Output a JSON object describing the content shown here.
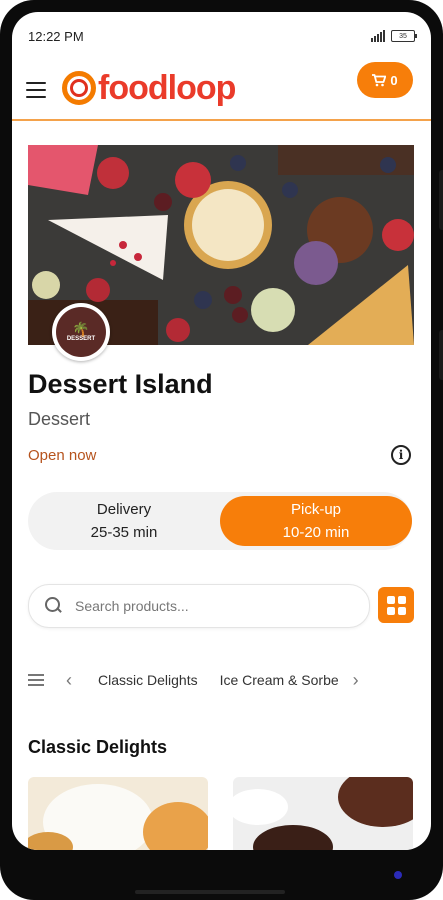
{
  "status_bar": {
    "time": "12:22 PM",
    "battery": "35"
  },
  "header": {
    "logo_text": "foodloop",
    "cart_count": "0"
  },
  "restaurant": {
    "name": "Dessert Island",
    "category": "Dessert",
    "open_status": "Open now",
    "logo_text": "DESSERT"
  },
  "order_mode": {
    "delivery": {
      "label": "Delivery",
      "time": "25-35 min"
    },
    "pickup": {
      "label": "Pick-up",
      "time": "10-20 min"
    },
    "selected": "pickup"
  },
  "search": {
    "placeholder": "Search products..."
  },
  "categories": [
    "Classic Delights",
    "Ice Cream & Sorbe"
  ],
  "section": {
    "title": "Classic Delights"
  },
  "colors": {
    "accent": "#f77e0a",
    "brand_red": "#ea3b2a",
    "open": "#b6531d"
  },
  "icons": [
    "menu-icon",
    "cart-icon",
    "info-icon",
    "search-icon",
    "grid-view-icon",
    "list-icon",
    "chevron-left-icon",
    "chevron-right-icon"
  ]
}
